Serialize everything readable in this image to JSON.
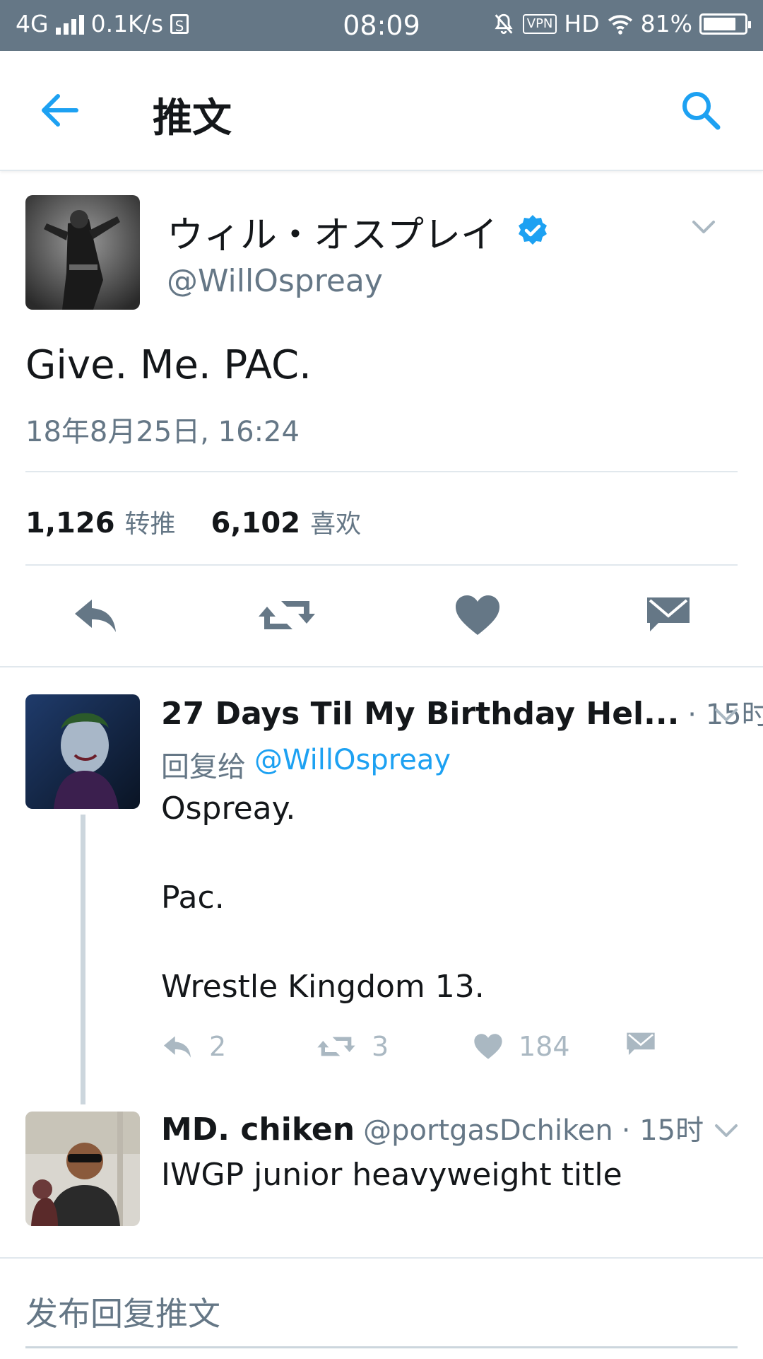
{
  "status_bar": {
    "network": "4G",
    "speed": "0.1K/s",
    "sim_badge": "S",
    "time": "08:09",
    "vpn": "VPN",
    "hd": "HD",
    "battery": "81%",
    "battery_level": 0.81
  },
  "header": {
    "title": "推文",
    "back_icon": "arrow-left-icon",
    "search_icon": "search-icon"
  },
  "tweet": {
    "display_name": "ウィル・オスプレイ",
    "handle": "@WillOspreay",
    "verified": true,
    "text": "Give. Me. PAC.",
    "timestamp": "18年8月25日, 16:24",
    "retweets_count": "1,126",
    "retweets_label": "转推",
    "likes_count": "6,102",
    "likes_label": "喜欢",
    "actions": [
      "reply-icon",
      "retweet-icon",
      "heart-icon",
      "message-icon"
    ]
  },
  "replies": [
    {
      "display_name": "27 Days Til My Birthday Hel...",
      "time": "· 15时",
      "reply_to_label": "回复给",
      "reply_to_handle": "@WillOspreay",
      "text_lines": [
        "Ospreay.",
        "Pac.",
        "Wrestle Kingdom 13."
      ],
      "reply_count": "2",
      "retweet_count": "3",
      "like_count": "184"
    },
    {
      "display_name": "MD. chiken",
      "handle": "@portgasDchiken",
      "time": "· 15时",
      "text": "IWGP junior heavyweight title"
    }
  ],
  "compose": {
    "placeholder": "发布回复推文"
  },
  "colors": {
    "status_bar": "#657786",
    "accent": "#1da1f2",
    "muted": "#657786",
    "icon": "#657786",
    "divider": "#e1e8ed"
  }
}
